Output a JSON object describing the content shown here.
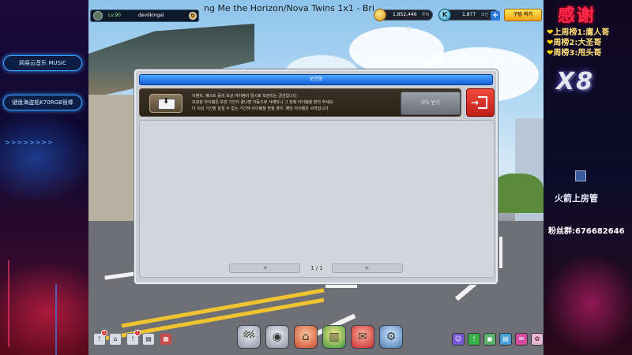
{
  "stream": {
    "left": {
      "music_badge": "网易云音乐 MUSIC",
      "kbd_badge": "键盘海盗船K70RGB很棒",
      "arrows": ">>>>>>>>"
    },
    "right": {
      "thanks": "感谢",
      "ranks": [
        {
          "label": "上周榜1:",
          "name": "庸人哥"
        },
        {
          "label": "周榜2:",
          "name": "大圣哥"
        },
        {
          "label": "周榜3:",
          "name": "甩头哥"
        }
      ],
      "logo": "X8",
      "rocket_label": "火箭上房管",
      "fan_group": "粉丝群:676682646"
    }
  },
  "hud": {
    "player_level": "Lv.90",
    "player_name": "devilkingal",
    "rank_badge": "G",
    "song_ticker": "ng Me the Horizon/Nova Twins     1x1 - Bri",
    "coins": {
      "value": "1,852,446",
      "unit": "루찌"
    },
    "kp": {
      "value": "1,877",
      "unit": "코인",
      "icon": "K",
      "plus": "+"
    },
    "buy_label": "구입 하기"
  },
  "modal": {
    "title": "보관함",
    "notice_lines": [
      "이벤트, 퀘스트 등의 보상 아이템이 임시로 보관되는 공간입니다.",
      "보관된 아이템은 보관 기간이 끝나면 자동으로 삭제되니 그 전에 아이템을 받아 주세요.",
      "더 이상 기간을 늘릴 수 없는 기간제 아이템을 받을 경우, 해당 아이템은 사라집니다."
    ],
    "receive_all": "모두 받기",
    "pager": {
      "prev": "◀",
      "next": "▶",
      "page": "1 / 1"
    }
  },
  "bottom_bar": {
    "left_icons": [
      "!",
      "⌂",
      "!",
      "▤",
      "▦"
    ],
    "left_badges": [
      "1",
      "1"
    ],
    "center_icons": [
      "🏁",
      "◉",
      "⌂",
      "▥",
      "✉",
      "⚙"
    ],
    "right_icons": [
      "☺",
      "!",
      "▣",
      "▤",
      "✉",
      "✿"
    ]
  },
  "colors": {
    "title_bar": "#1560d8",
    "exit_button": "#e0342a",
    "buy_button": "#f0a010",
    "thanks_text": "#ff2a4a"
  }
}
